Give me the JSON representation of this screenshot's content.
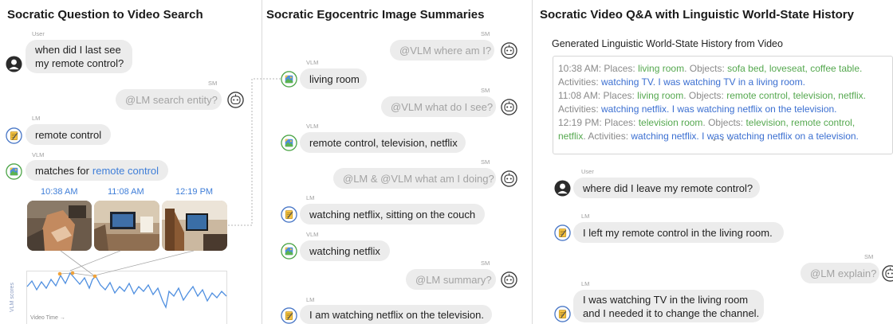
{
  "titles": {
    "left": "Socratic Question to Video Search",
    "middle": "Socratic Egocentric Image Summaries",
    "right": "Socratic Video Q&A with Linguistic World-State History"
  },
  "left": {
    "m1": {
      "speaker": "User",
      "line1": "when did I last see",
      "line2": "my remote control?"
    },
    "m2": {
      "speaker": "SM",
      "text": "@LM search entity?"
    },
    "m3": {
      "speaker": "LM",
      "text": "remote control"
    },
    "m4": {
      "speaker": "VLM",
      "prefix": "matches for",
      "link": "remote control"
    },
    "times": [
      "10:38 AM",
      "11:08 AM",
      "12:19 PM"
    ],
    "plot": {
      "ylabel": "VLM scores",
      "xlabel": "Video Time →"
    }
  },
  "middle": {
    "m1": {
      "speaker": "SM",
      "text": "@VLM where am I?"
    },
    "m2": {
      "speaker": "VLM",
      "text": "living room"
    },
    "m3": {
      "speaker": "SM",
      "text": "@VLM what do I see?"
    },
    "m4": {
      "speaker": "VLM",
      "text": "remote control, television, netflix"
    },
    "m5": {
      "speaker": "SM",
      "text": "@LM & @VLM what am I doing?"
    },
    "m6": {
      "speaker": "LM",
      "text": "watching netflix, sitting on the couch"
    },
    "m7": {
      "speaker": "VLM",
      "text": "watching netflix"
    },
    "m8": {
      "speaker": "SM",
      "text": "@LM summary?"
    },
    "m9": {
      "speaker": "LM",
      "text": "I am watching netflix on the television."
    }
  },
  "right": {
    "history_title": "Generated Linguistic World-State History from Video",
    "history": {
      "l1": {
        "a": "10:38 AM: Places: ",
        "b": "living room",
        "c": ". Objects: ",
        "d": "sofa bed, loveseat, coffee table."
      },
      "l2": {
        "a": "Activities: ",
        "b": "watching TV. I was watching TV in a living room."
      },
      "l3": {
        "a": "11:08 AM: Places: ",
        "b": "living room",
        "c": ". Objects: ",
        "d": "remote control, television, netflix."
      },
      "l4": {
        "a": "Activities: ",
        "b": "watching netflix. I was watching netflix on the television."
      },
      "l5": {
        "a": "12:19 PM: Places: ",
        "b": "television room",
        "c": ". Objects: ",
        "d": "television, remote control,"
      },
      "l6": {
        "a": "netflix",
        "b": ". Activities: ",
        "c": "watching netflix. I was watching netflix on a television."
      },
      "ellipsis": "• • •"
    },
    "m1": {
      "speaker": "User",
      "text": "where did I leave my remote control?"
    },
    "m2": {
      "speaker": "LM",
      "text": "I left my remote control in the living room."
    },
    "m3": {
      "speaker": "SM",
      "text": "@LM explain?"
    },
    "m4": {
      "speaker": "LM",
      "line1": "I was watching TV in the living room",
      "line2": "and I needed it to change the channel."
    }
  },
  "colors": {
    "link": "#3f7ed8",
    "green_text": "#55a84f",
    "blue_text": "#3b6fd1",
    "bubble": "#ececec"
  }
}
